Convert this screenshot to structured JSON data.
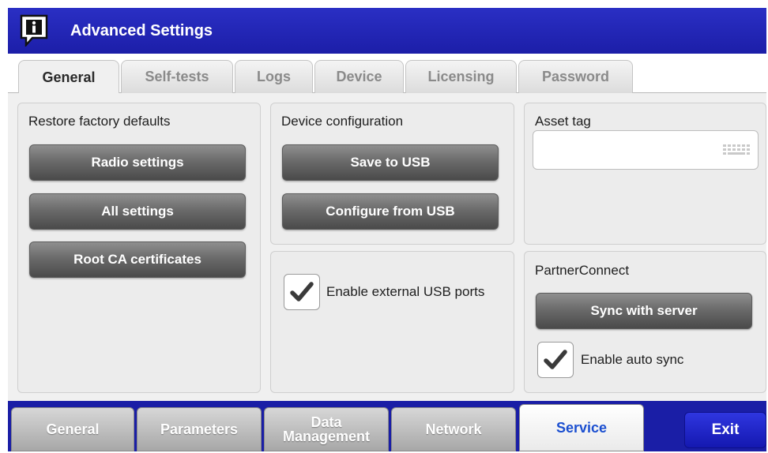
{
  "window": {
    "title": "Advanced Settings"
  },
  "top_tabs": [
    {
      "label": "General",
      "active": true
    },
    {
      "label": "Self-tests",
      "active": false
    },
    {
      "label": "Logs",
      "active": false
    },
    {
      "label": "Device",
      "active": false
    },
    {
      "label": "Licensing",
      "active": false
    },
    {
      "label": "Password",
      "active": false
    }
  ],
  "restore": {
    "title": "Restore factory defaults",
    "buttons": [
      "Radio settings",
      "All settings",
      "Root CA certificates"
    ]
  },
  "device_config": {
    "title": "Device configuration",
    "buttons": [
      "Save to USB",
      "Configure from USB"
    ]
  },
  "usb": {
    "label": "Enable external USB ports",
    "checked": true
  },
  "asset": {
    "title": "Asset tag",
    "value": ""
  },
  "partner": {
    "title": "PartnerConnect",
    "sync_button": "Sync with server",
    "auto_sync_label": "Enable auto sync",
    "auto_sync_checked": true
  },
  "bottom_tabs": [
    {
      "label": "General",
      "active": false
    },
    {
      "label": "Parameters",
      "active": false
    },
    {
      "label": "Data Management",
      "line1": "Data",
      "line2": "Management",
      "active": false
    },
    {
      "label": "Network",
      "active": false
    },
    {
      "label": "Service",
      "active": true
    }
  ],
  "exit_label": "Exit",
  "icons": {
    "title": "info-icon",
    "keyboard": "keyboard-icon",
    "check": "checkmark-icon"
  },
  "colors": {
    "titlebar": "#1c1ea8",
    "active_tab_text": "#1b4fd0",
    "exit": "#1418b0"
  }
}
